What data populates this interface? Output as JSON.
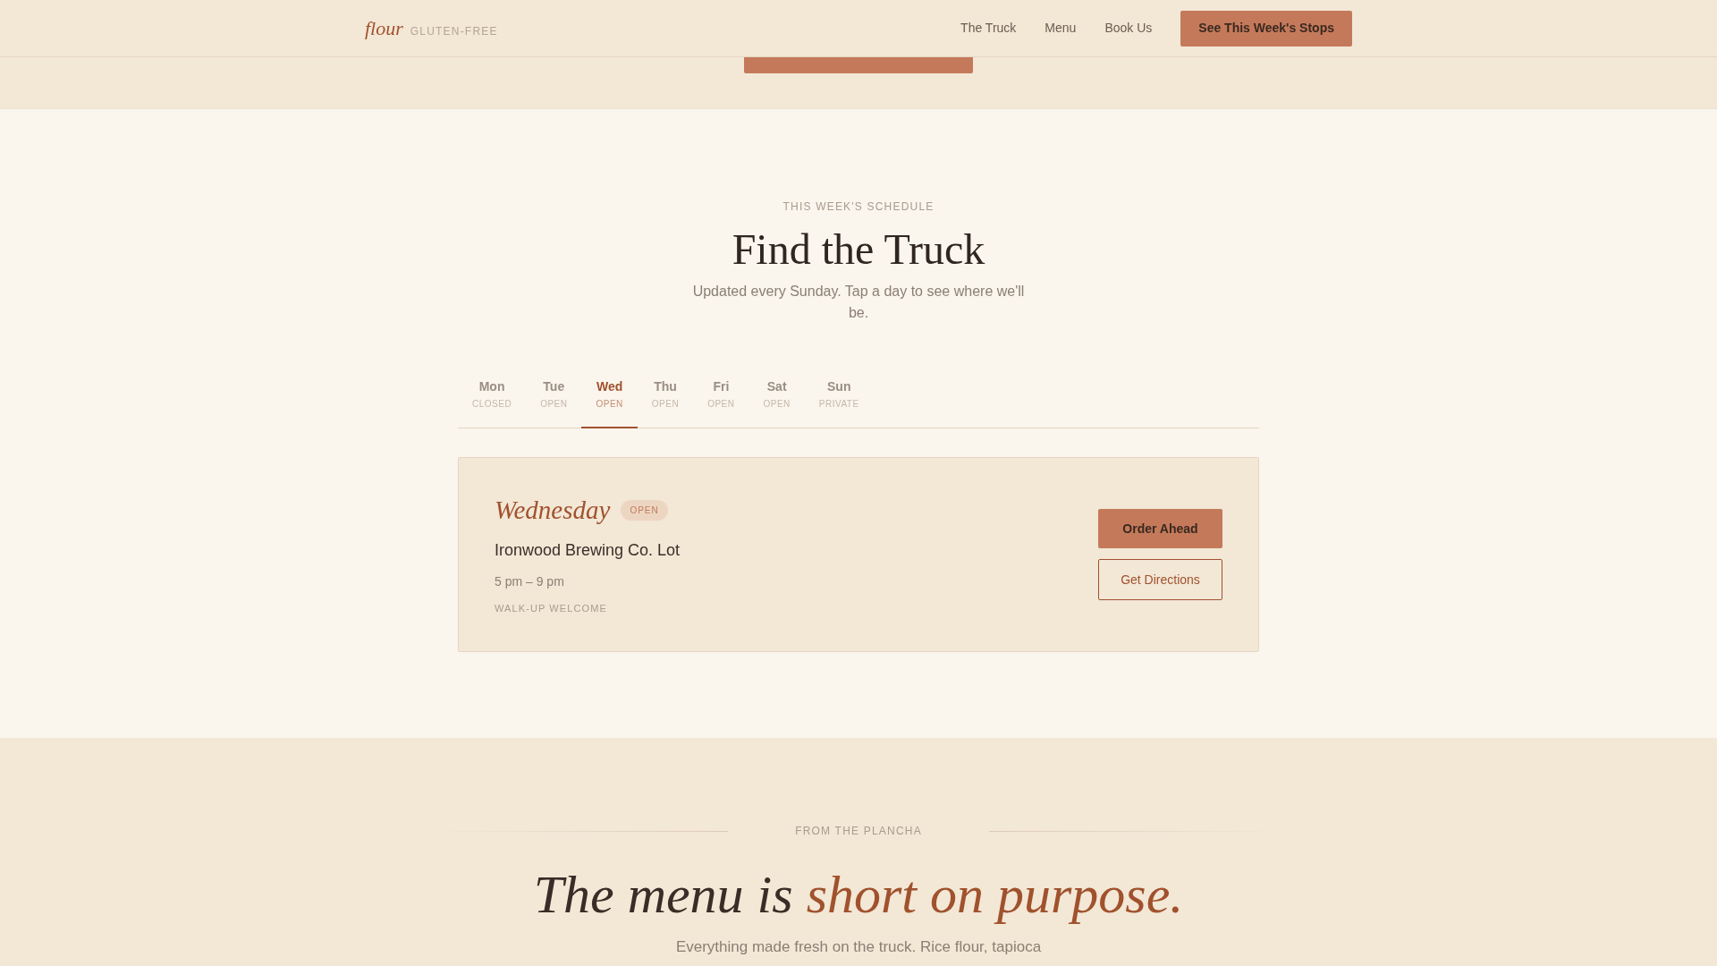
{
  "header": {
    "logo": "flour",
    "tagline": "GLUTEN-FREE",
    "nav": [
      "The Truck",
      "Menu",
      "Book Us"
    ],
    "cta": "See This Week's Stops"
  },
  "schedule": {
    "eyebrow": "THIS WEEK'S SCHEDULE",
    "title": "Find the Truck",
    "subtitle": "Updated every Sunday. Tap a day to see where we'll be.",
    "tabs": [
      {
        "day": "Mon",
        "status": "CLOSED",
        "selected": false
      },
      {
        "day": "Tue",
        "status": "OPEN",
        "selected": false
      },
      {
        "day": "Wed",
        "status": "OPEN",
        "selected": true
      },
      {
        "day": "Thu",
        "status": "OPEN",
        "selected": false
      },
      {
        "day": "Fri",
        "status": "OPEN",
        "selected": false
      },
      {
        "day": "Sat",
        "status": "OPEN",
        "selected": false
      },
      {
        "day": "Sun",
        "status": "PRIVATE",
        "selected": false
      }
    ],
    "detail": {
      "day": "Wednesday",
      "badge": "OPEN",
      "location": "Ironwood Brewing Co. Lot",
      "hours": "5 pm – 9 pm",
      "note": "WALK-UP WELCOME",
      "buttons": [
        {
          "label": "Order Ahead",
          "kind": "primary"
        },
        {
          "label": "Get Directions",
          "kind": "outline"
        }
      ]
    }
  },
  "menu": {
    "eyebrow": "FROM THE PLANCHA",
    "title": {
      "text": "The menu is",
      "accent": "short on purpose."
    },
    "subtitle": "Everything made fresh on the truck. Rice flour, tapioca"
  }
}
